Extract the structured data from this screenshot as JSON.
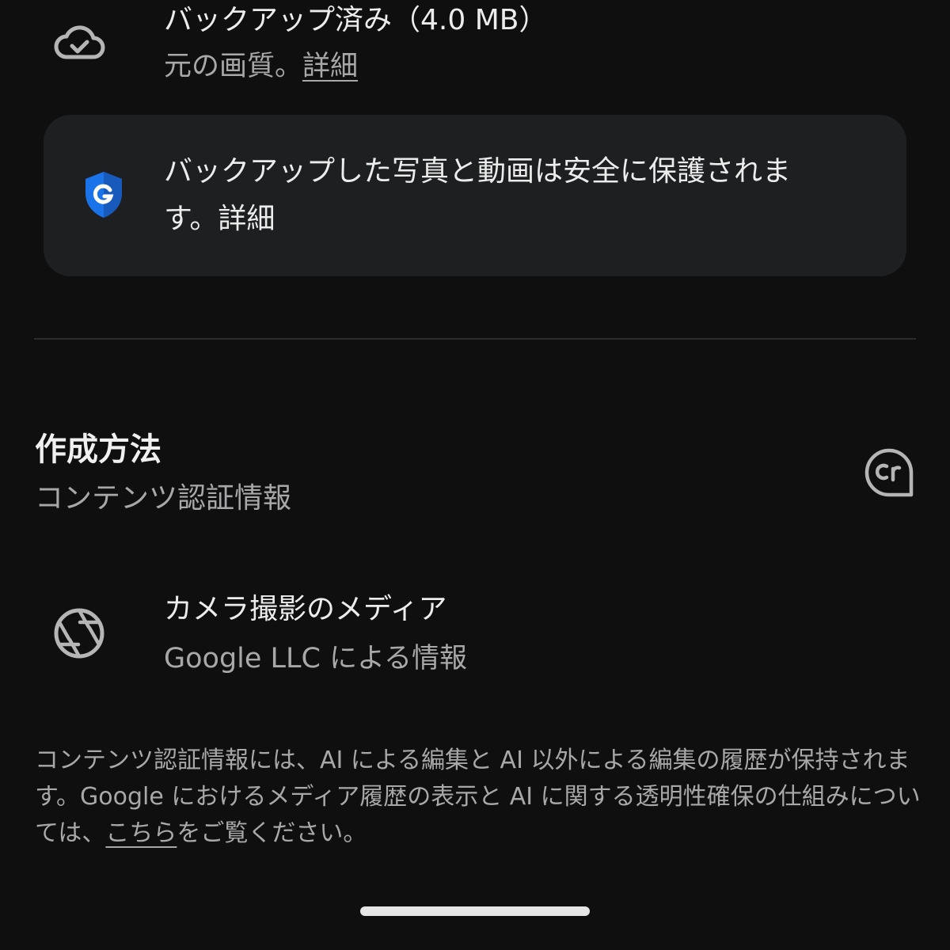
{
  "backup": {
    "icon": "cloud-done-icon",
    "title": "バックアップ済み（4.0 MB）",
    "quality_text": "元の画質。",
    "details_link": "詳細"
  },
  "security_card": {
    "icon": "google-shield-icon",
    "brand_color": "#1a73e8",
    "text": "バックアップした写真と動画は安全に保護されます。",
    "details_link": "詳細"
  },
  "creation": {
    "title": "作成方法",
    "subtitle": "コンテンツ認証情報",
    "icon": "content-credentials-cr-icon"
  },
  "camera": {
    "icon": "camera-aperture-icon",
    "title": "カメラ撮影のメディア",
    "subtitle": "Google LLC による情報"
  },
  "info": {
    "text_before": "コンテンツ認証情報には、AI による編集と AI 以外による編集の履歴が保持されます。Google におけるメディア履歴の表示と AI に関する透明性確保の仕組みについては、",
    "link_text": "こちら",
    "text_after": "をご覧ください。"
  }
}
